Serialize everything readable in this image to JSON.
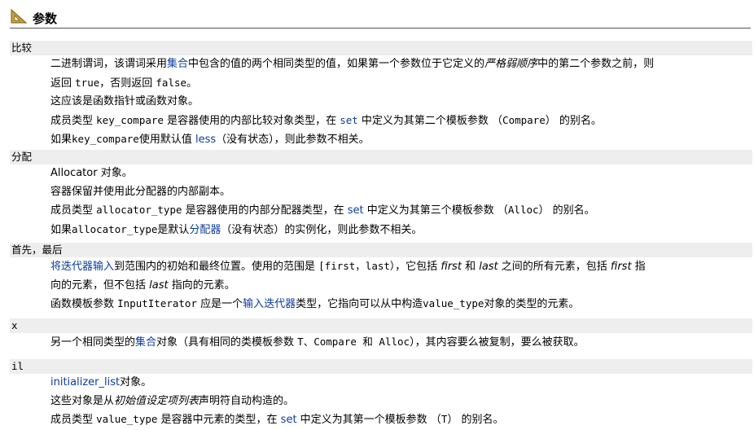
{
  "header": {
    "title": "参数"
  },
  "params": {
    "compare": {
      "term": "比较",
      "l1_a": "二进制谓词，该谓词采用",
      "l1_link": "集合",
      "l1_b": "中包含的值的两个相同类型的值，如果第一个参数位于它定义的",
      "l1_em": "严格弱顺序",
      "l1_c": "中的第二个参数之前，则",
      "l2_a": "返回 ",
      "l2_true": "true",
      "l2_b": "，否则返回 ",
      "l2_false": "false",
      "l2_c": "。",
      "l3": "这应该是函数指针或函数对象。",
      "l4_a": "成员类型 ",
      "l4_code": "key_compare",
      "l4_b": " 是容器使用的内部比较对象类型，在 ",
      "l4_link": "set",
      "l4_c": " 中定义为其第二个模板参数 （",
      "l4_code2": "Compare",
      "l4_d": "） 的别名。",
      "l5_a": "如果",
      "l5_code": "key_compare",
      "l5_b": "使用默认值 ",
      "l5_link": "less",
      "l5_c": "（没有状态），则此参数不相关。"
    },
    "alloc": {
      "term": "分配",
      "l1": "Allocator 对象。",
      "l2": "容器保留并使用此分配器的内部副本。",
      "l3_a": "成员类型 ",
      "l3_code": "allocator_type",
      "l3_b": " 是容器使用的内部分配器类型，在 ",
      "l3_link": "set",
      "l3_c": " 中定义为其第三个模板参数 （",
      "l3_code2": "Alloc",
      "l3_d": "） 的别名。",
      "l4_a": "如果",
      "l4_code": "allocator_type",
      "l4_b": "是默认",
      "l4_link": "分配器",
      "l4_c": "（没有状态）的实例化，则此参数不相关。"
    },
    "firstlast": {
      "term": "首先，最后",
      "l1_link": "将迭代器输入",
      "l1_a": "到范围内的初始和最终位置。使用的范围是 ",
      "l1_code": "[first，last）",
      "l1_b": "，它包括 ",
      "l1_em1": "first",
      "l1_c": " 和 ",
      "l1_em2": "last",
      "l1_d": " 之间的所有元素，包括 ",
      "l1_em3": "first",
      "l1_e": " 指",
      "l2_a": "向的元素，但不包括 ",
      "l2_em": "last",
      "l2_b": " 指向的元素。",
      "l3_a": "函数模板参数 ",
      "l3_code": "InputIterator",
      "l3_b": " 应是一个",
      "l3_link": "输入迭代器",
      "l3_c": "类型，它指向可以从中构造",
      "l3_code2": "value_type",
      "l3_d": "对象的类型的元素。"
    },
    "x": {
      "term": "x",
      "l1_a": "另一个相同类型的",
      "l1_link": "集合",
      "l1_b": "对象（具有相同的类模板参数 ",
      "l1_code": "T、Compare 和 Alloc",
      "l1_c": "），其内容要么被复制，要么被获取。"
    },
    "il": {
      "term": "il",
      "l1_link": "initializer_list",
      "l1_a": "对象。",
      "l2_a": "这些对象是从",
      "l2_em": "初始值设定项列表",
      "l2_b": "声明符自动构造的。",
      "l3_a": "成员类型 ",
      "l3_code": "value_type",
      "l3_b": " 是容器中元素的类型，在 ",
      "l3_link": "set",
      "l3_c": " 中定义为其第一个模板参数 （",
      "l3_code2": "T",
      "l3_d": "） 的别名。"
    }
  }
}
